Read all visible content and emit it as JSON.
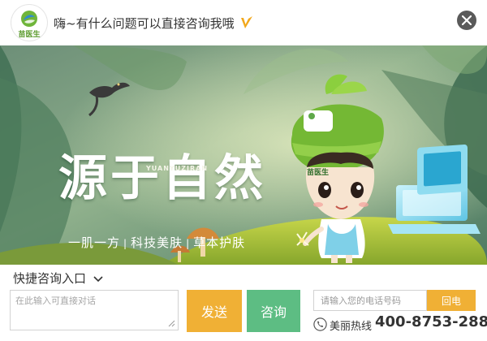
{
  "header": {
    "logo_text": "苗医生",
    "greeting": "嗨~有什么问题可以直接咨询我哦"
  },
  "banner": {
    "title": "源于自然",
    "subtitle_en": "YUANYUZIRAN",
    "slogan": [
      "一肌一方",
      "科技美肤",
      "草本护肤"
    ],
    "separator": "|",
    "hat_badge_text": "苗医生"
  },
  "bottom": {
    "quick_consult_label": "快捷咨询入口",
    "message_placeholder": "在此输入可直接对话",
    "send_label": "发送",
    "consult_label": "咨询",
    "phone_placeholder": "请输入您的电话号码",
    "callback_label": "回电",
    "hotline_label": "美丽热线",
    "hotline_number": "400-8753-288"
  },
  "colors": {
    "send": "#f0b035",
    "consult": "#5dbd83",
    "callback": "#f0b035",
    "close_button": "#5a5a5a"
  },
  "icons": [
    "logo-icon",
    "v-badge-icon",
    "close-icon",
    "chevron-down-icon",
    "resize-grip-icon",
    "phone-icon"
  ]
}
